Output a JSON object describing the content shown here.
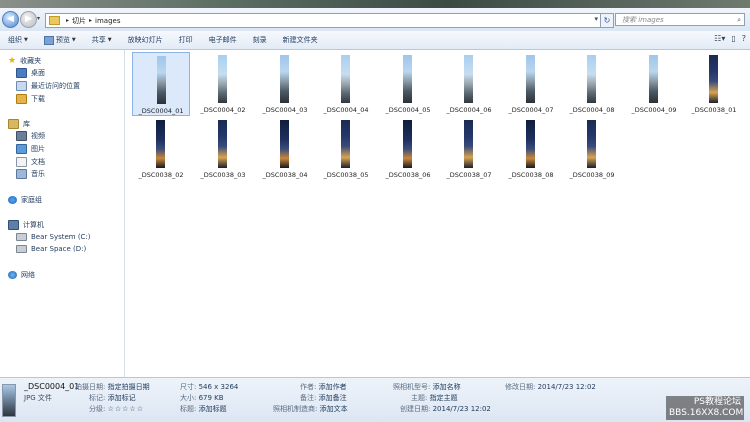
{
  "address": {
    "crumbs": [
      "切片",
      "images"
    ],
    "search_placeholder": "搜索 images"
  },
  "toolbar": {
    "organize": "组织",
    "preview": "预览",
    "share": "共享",
    "slideshow": "放映幻灯片",
    "print": "打印",
    "email": "电子邮件",
    "burn": "刻录",
    "new_folder": "新建文件夹"
  },
  "sidebar": {
    "favorites": "收藏夹",
    "desktop": "桌面",
    "recent": "最近访问的位置",
    "downloads": "下载",
    "libraries": "库",
    "videos": "视频",
    "pictures": "图片",
    "documents": "文档",
    "music": "音乐",
    "homegroup": "家庭组",
    "computer": "计算机",
    "drive_c": "Bear System (C:)",
    "drive_d": "Bear Space (D:)",
    "network": "网络"
  },
  "files": [
    {
      "name": "_DSC0004_01"
    },
    {
      "name": "_DSC0004_02"
    },
    {
      "name": "_DSC0004_03"
    },
    {
      "name": "_DSC0004_04"
    },
    {
      "name": "_DSC0004_05"
    },
    {
      "name": "_DSC0004_06"
    },
    {
      "name": "_DSC0004_07"
    },
    {
      "name": "_DSC0004_08"
    },
    {
      "name": "_DSC0004_09"
    },
    {
      "name": "_DSC0038_01"
    },
    {
      "name": "_DSC0038_02"
    },
    {
      "name": "_DSC0038_03"
    },
    {
      "name": "_DSC0038_04"
    },
    {
      "name": "_DSC0038_05"
    },
    {
      "name": "_DSC0038_06"
    },
    {
      "name": "_DSC0038_07"
    },
    {
      "name": "_DSC0038_08"
    },
    {
      "name": "_DSC0038_09"
    }
  ],
  "details": {
    "name": "_DSC0004_01",
    "type": "JPG 文件",
    "date_taken_k": "拍摄日期:",
    "date_taken_v": "指定拍摄日期",
    "tags_k": "标记:",
    "tags_v": "添加标记",
    "rating_k": "分级:",
    "rating_v": "☆☆☆☆☆",
    "dims_k": "尺寸:",
    "dims_v": "546 x 3264",
    "size_k": "大小:",
    "size_v": "679 KB",
    "title_k": "标题:",
    "title_v": "添加标题",
    "author_k": "作者:",
    "author_v": "添加作者",
    "comments_k": "备注:",
    "comments_v": "添加备注",
    "maker_k": "照相机制造商:",
    "maker_v": "添加文本",
    "model_k": "照相机型号:",
    "model_v": "添加名称",
    "subject_k": "主题:",
    "subject_v": "指定主题",
    "created_k": "创建日期:",
    "created_v": "2014/7/23 12:02",
    "modified_k": "修改日期:",
    "modified_v": "2014/7/23 12:02"
  },
  "watermark": {
    "line1": "PS教程论坛",
    "line2": "BBS.16XX8.COM"
  }
}
